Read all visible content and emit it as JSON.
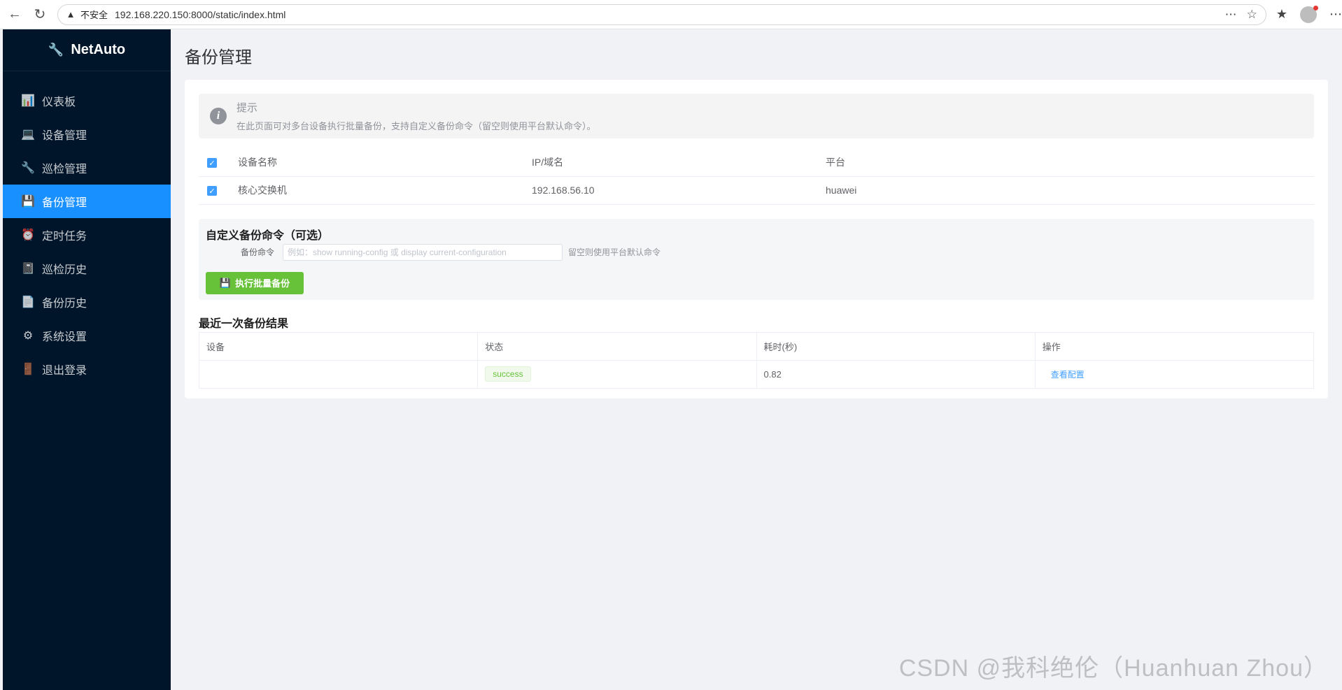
{
  "browser": {
    "security_label": "不安全",
    "url": "192.168.220.150:8000/static/index.html"
  },
  "sidebar": {
    "brand": "NetAuto",
    "items": [
      {
        "label": "仪表板",
        "icon": "dashboard-icon"
      },
      {
        "label": "设备管理",
        "icon": "device-icon"
      },
      {
        "label": "巡检管理",
        "icon": "wrench-icon"
      },
      {
        "label": "备份管理",
        "icon": "floppy-disk-icon"
      },
      {
        "label": "定时任务",
        "icon": "alarm-clock-icon"
      },
      {
        "label": "巡检历史",
        "icon": "notebook-icon"
      },
      {
        "label": "备份历史",
        "icon": "document-icon"
      },
      {
        "label": "系统设置",
        "icon": "gear-icon"
      },
      {
        "label": "退出登录",
        "icon": "door-icon"
      }
    ],
    "active_index": 3
  },
  "page": {
    "title": "备份管理"
  },
  "tip": {
    "title": "提示",
    "desc": "在此页面可对多台设备执行批量备份，支持自定义备份命令（留空则使用平台默认命令）。"
  },
  "device_table": {
    "headers": [
      "设备名称",
      "IP/域名",
      "平台"
    ],
    "rows": [
      {
        "name": "核心交换机",
        "ip": "192.168.56.10",
        "platform": "huawei",
        "checked": true
      }
    ]
  },
  "custom_cmd": {
    "title": "自定义备份命令（可选）",
    "label": "备份命令",
    "placeholder": "例如：show running-config 或 display current-configuration",
    "value": "",
    "hint": "留空则使用平台默认命令",
    "button_label": "执行批量备份"
  },
  "result": {
    "title": "最近一次备份结果",
    "headers": [
      "设备",
      "状态",
      "耗时(秒)",
      "操作"
    ],
    "rows": [
      {
        "device": "",
        "status": "success",
        "duration": "0.82",
        "action": "查看配置"
      }
    ]
  },
  "watermark": "CSDN @我科绝伦（Huanhuan Zhou）",
  "colors": {
    "sidebar_bg": "#001529",
    "active": "#1890ff",
    "success": "#67c23a",
    "link": "#409eff"
  }
}
